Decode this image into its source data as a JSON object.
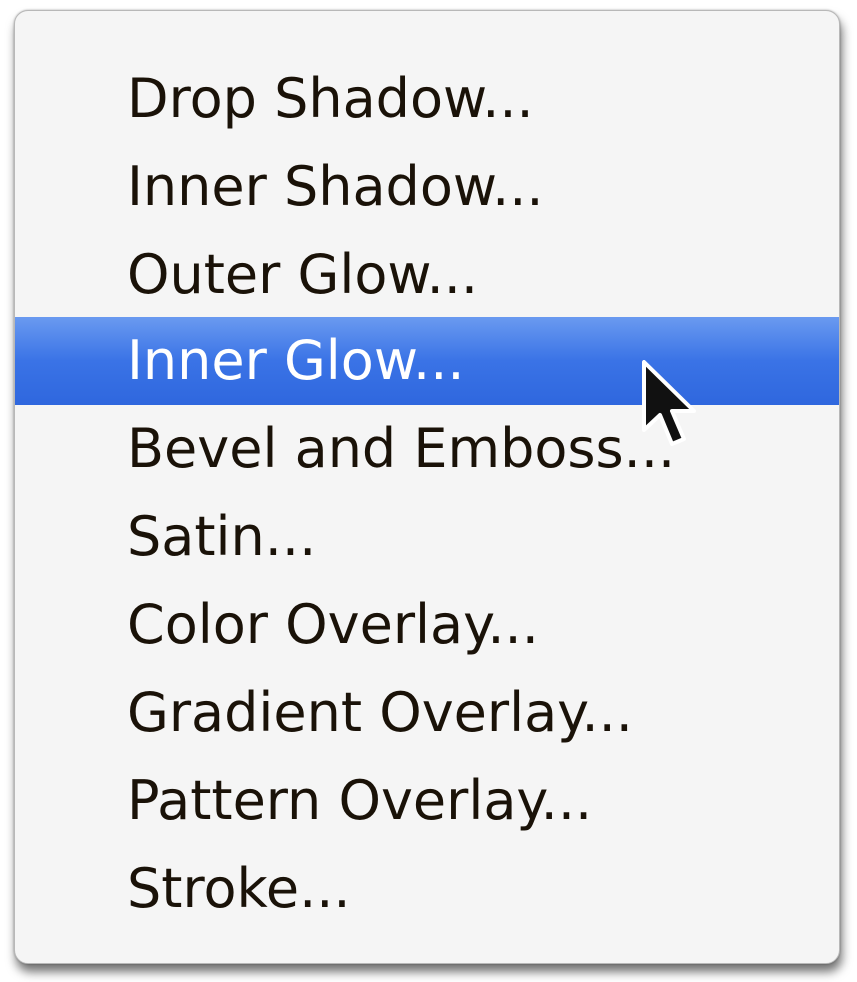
{
  "menu": {
    "items": [
      {
        "label": "Drop Shadow..."
      },
      {
        "label": "Inner Shadow..."
      },
      {
        "label": "Outer Glow..."
      },
      {
        "label": "Inner Glow...",
        "selected": true
      },
      {
        "label": "Bevel and Emboss..."
      },
      {
        "label": "Satin..."
      },
      {
        "label": "Color Overlay..."
      },
      {
        "label": "Gradient Overlay..."
      },
      {
        "label": "Pattern Overlay..."
      },
      {
        "label": "Stroke..."
      }
    ],
    "highlight_color": "#3a73e6",
    "background_color": "#f5f5f5",
    "text_color": "#1a1208"
  },
  "cursor": {
    "icon": "arrow-pointer-icon"
  }
}
